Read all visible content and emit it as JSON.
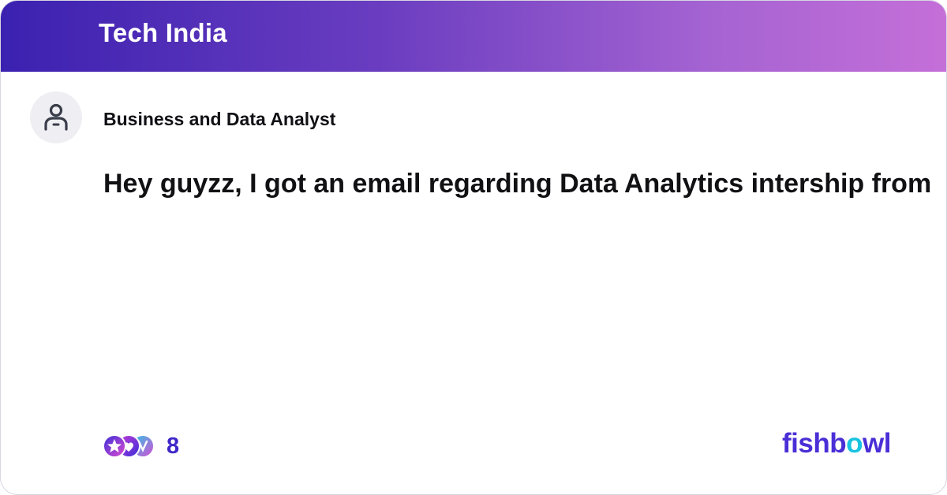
{
  "header": {
    "group_name": "Tech India"
  },
  "post": {
    "author_icon": "user-avatar-icon",
    "author": "Business and Data Analyst",
    "text": "Hey guyzz, I got an email regarding Data Analytics intership from..."
  },
  "reactions": {
    "icons": [
      "star-reaction-icon",
      "heart-reaction-icon",
      "clap-reaction-icon"
    ],
    "count": "8"
  },
  "brand": {
    "name_part1": "fishb",
    "name_o": "o",
    "name_part2": "wl"
  },
  "colors": {
    "header_gradient_start": "#3b21b0",
    "header_gradient_end": "#c56fd8",
    "brand": "#4a2fd6",
    "brand_accent": "#18c3e0",
    "reaction_count": "#3f28c8"
  }
}
